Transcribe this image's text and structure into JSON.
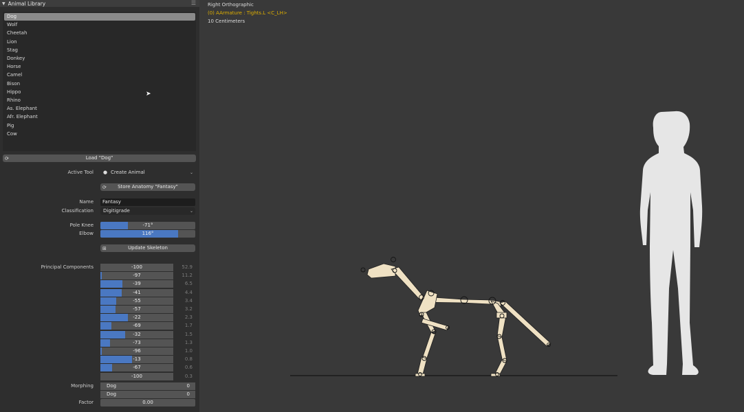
{
  "panel": {
    "header_title": "Animal Library",
    "animals": [
      "Dog",
      "Wolf",
      "Cheetah",
      "Lion",
      "Stag",
      "Donkey",
      "Horse",
      "Camel",
      "Bison",
      "Hippo",
      "Rhino",
      "As. Elephant",
      "Afr. Elephant",
      "Pig",
      "Cow"
    ],
    "selected_animal": "Dog",
    "load_button": "Load \"Dog\"",
    "active_tool_label": "Active Tool",
    "active_tool_value": "Create Animal",
    "store_button": "Store Anatomy \"Fantasy\"",
    "name_label": "Name",
    "name_value": "Fantasy",
    "classification_label": "Classification",
    "classification_value": "Digitigrade",
    "pole_knee_label": "Pole Knee",
    "pole_knee_value": "-71°",
    "pole_knee_fraction": 0.29,
    "elbow_label": "Elbow",
    "elbow_value": "116°",
    "elbow_fraction": 0.82,
    "update_button": "Update Skeleton",
    "pc_label": "Principal Components",
    "principal_components": [
      {
        "value": "-100",
        "fill": 0.0,
        "right": "52.9"
      },
      {
        "value": "-97",
        "fill": 0.015,
        "right": "11.2"
      },
      {
        "value": "-39",
        "fill": 0.3,
        "right": "6.5"
      },
      {
        "value": "-41",
        "fill": 0.29,
        "right": "4.4"
      },
      {
        "value": "-55",
        "fill": 0.22,
        "right": "3.4"
      },
      {
        "value": "-57",
        "fill": 0.21,
        "right": "3.2"
      },
      {
        "value": "-22",
        "fill": 0.38,
        "right": "2.3"
      },
      {
        "value": "-69",
        "fill": 0.15,
        "right": "1.7"
      },
      {
        "value": "-32",
        "fill": 0.34,
        "right": "1.5"
      },
      {
        "value": "-73",
        "fill": 0.13,
        "right": "1.3"
      },
      {
        "value": "-96",
        "fill": 0.02,
        "right": "1.0"
      },
      {
        "value": "-13",
        "fill": 0.43,
        "right": "0.8"
      },
      {
        "value": "-67",
        "fill": 0.16,
        "right": "0.6"
      },
      {
        "value": "-100",
        "fill": 0.0,
        "right": "0.3"
      }
    ],
    "morphing_label": "Morphing",
    "morphing_rows": [
      {
        "name": "Dog",
        "value": "0"
      },
      {
        "name": "Dog",
        "value": "0"
      }
    ],
    "factor_label": "Factor",
    "factor_value": "0.00"
  },
  "viewport": {
    "view_name": "Right Orthographic",
    "object_info": "(0) AArmature : Tights.L <C_LH>",
    "scale_info": "10 Centimeters",
    "accent_color": "#e0b000",
    "bone_color": "#efe1c3"
  }
}
